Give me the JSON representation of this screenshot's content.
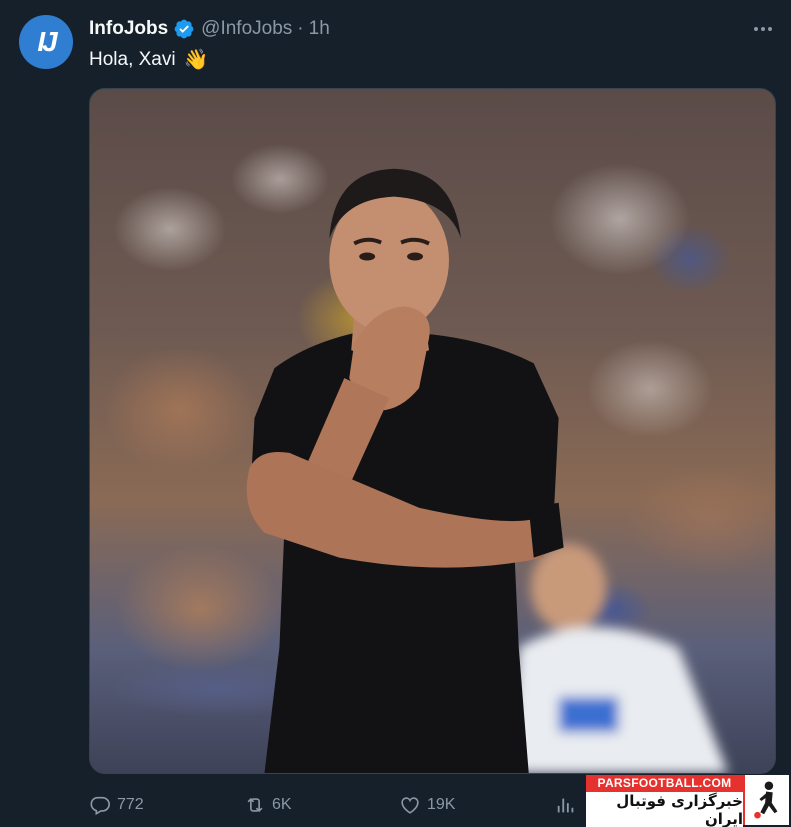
{
  "author": {
    "avatar_text": "IJ",
    "display_name": "InfoJobs",
    "handle": "@InfoJobs",
    "time": "1h",
    "verified": true
  },
  "tweet": {
    "text": "Hola, Xavi",
    "emoji": "👋"
  },
  "actions": {
    "replies": "772",
    "retweets": "6K",
    "likes": "19K"
  },
  "watermark": {
    "site": "PARSFOOTBALL.COM",
    "tagline": "خبرگزاری فوتبال ایران"
  },
  "colors": {
    "background": "#15202b",
    "verified": "#1d9bf0",
    "muted": "#8b98a5",
    "avatar": "#2f7ed2",
    "watermark_red": "#e6322e"
  }
}
